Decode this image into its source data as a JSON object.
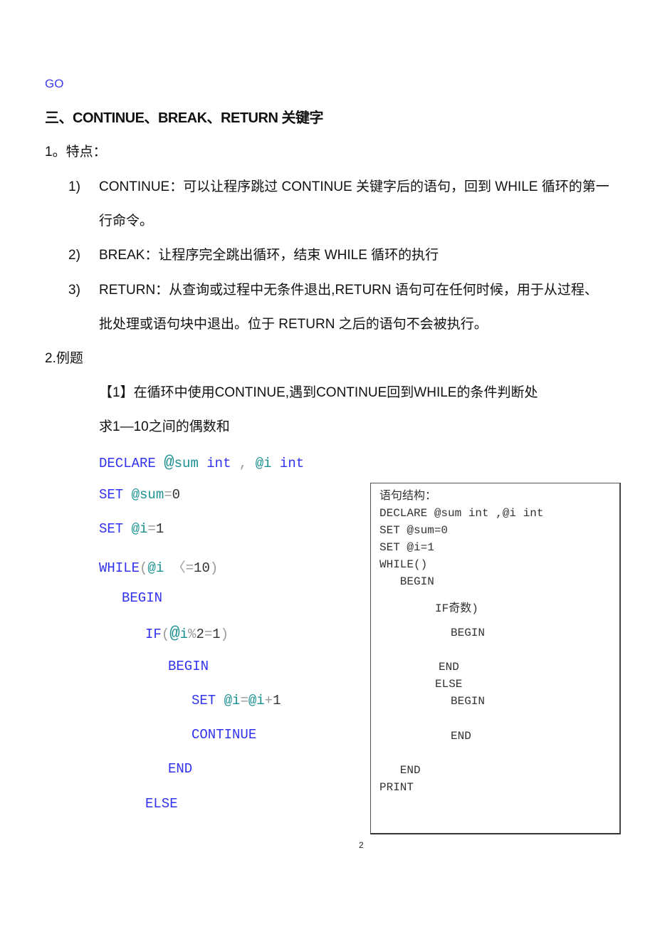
{
  "go_line": "GO",
  "section_title": "三、CONTINUE、BREAK、RETURN 关键字",
  "features": {
    "heading": "1。特点：",
    "items": [
      {
        "num": "1)",
        "line1": "CONTINUE：可以让程序跳过 CONTINUE 关键字后的语句，回到 WHILE 循环的第一",
        "line2": "行命令。"
      },
      {
        "num": "2)",
        "line1": "BREAK：让程序完全跳出循环，结束 WHILE 循环的执行"
      },
      {
        "num": "3)",
        "line1": "RETURN：从查询或过程中无条件退出,RETURN  语句可在任何时候，用于从过程、",
        "line2": "批处理或语句块中退出。位于 RETURN 之后的语句不会被执行。"
      }
    ]
  },
  "examples": {
    "heading": "2.例题",
    "example1_title": "【1】在循环中使用CONTINUE,遇到CONTINUE回到WHILE的条件判断处",
    "example1_task": "求1—10之间的偶数和"
  },
  "code": {
    "declare": {
      "kw": "DECLARE",
      "at1": "@",
      "v1": "sum",
      "t1": "int",
      "comma": ",",
      "v2": "@i",
      "t2": "int"
    },
    "set_sum": {
      "kw": "SET",
      "var": "@sum",
      "op": "=",
      "val": "0"
    },
    "set_i": {
      "kw": "SET",
      "var": "@i",
      "op": "=",
      "val": "1"
    },
    "while": {
      "kw": "WHILE",
      "open": "(",
      "var": "@i",
      "op": "〈=",
      "val": "10",
      "close": ")"
    },
    "begin1": "BEGIN",
    "if": {
      "kw": "IF",
      "open": "(",
      "at": "@",
      "var": "i",
      "op": "%",
      "val": "2",
      "eq": "=",
      "val2": "1",
      "close": ")"
    },
    "begin2": "BEGIN",
    "set_inc": {
      "kw": "SET",
      "var": "@i",
      "op": "=",
      "var2": "@i",
      "plus": "+",
      "val": "1"
    },
    "continue": "CONTINUE",
    "end2": "END",
    "else": "ELSE"
  },
  "structure_box": {
    "lines": [
      "语句结构：",
      "DECLARE @sum int ,@i int",
      "SET @sum=0",
      "SET @i=1",
      "WHILE()",
      "   BEGIN",
      "IF奇数)",
      "BEGIN",
      "END",
      "ELSE",
      "BEGIN",
      "END",
      "   END",
      "PRINT"
    ]
  },
  "page_number": "2"
}
